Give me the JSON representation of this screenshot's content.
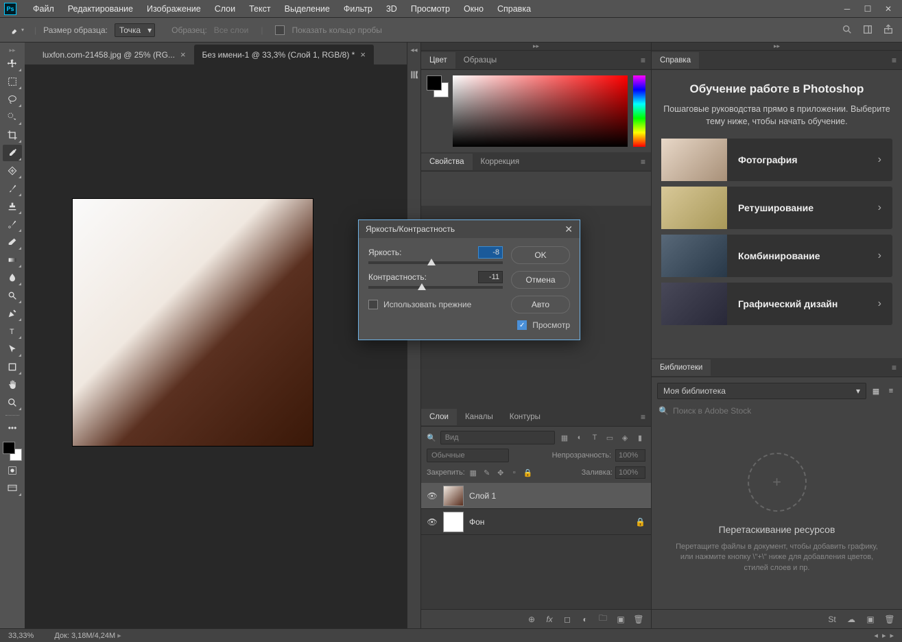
{
  "menu": [
    "Файл",
    "Редактирование",
    "Изображение",
    "Слои",
    "Текст",
    "Выделение",
    "Фильтр",
    "3D",
    "Просмотр",
    "Окно",
    "Справка"
  ],
  "options": {
    "sample_label": "Размер образца:",
    "sample_value": "Точка",
    "sample2_label": "Образец:",
    "sample2_value": "Все слои",
    "ring_label": "Показать кольцо пробы"
  },
  "tabs": [
    {
      "label": "luxfon.com-21458.jpg @ 25% (RG...",
      "active": false
    },
    {
      "label": "Без имени-1 @ 33,3% (Слой 1, RGB/8) *",
      "active": true
    }
  ],
  "color_tabs": [
    "Цвет",
    "Образцы"
  ],
  "props_tabs": [
    "Свойства",
    "Коррекция"
  ],
  "props_text": "",
  "layers_tabs": [
    "Слои",
    "Каналы",
    "Контуры"
  ],
  "layers": {
    "search_placeholder": "Вид",
    "blend": "Обычные",
    "opacity_label": "Непрозрачность:",
    "opacity_val": "100%",
    "lock_label": "Закрепить:",
    "fill_label": "Заливка:",
    "fill_val": "100%",
    "items": [
      {
        "name": "Слой 1",
        "active": true,
        "locked": false
      },
      {
        "name": "Фон",
        "active": false,
        "locked": true
      }
    ]
  },
  "help_tab": "Справка",
  "help": {
    "title": "Обучение работе в Photoshop",
    "sub": "Пошаговые руководства прямо в приложении. Выберите тему ниже, чтобы начать обучение.",
    "cards": [
      "Фотография",
      "Ретуширование",
      "Комбинирование",
      "Графический дизайн"
    ]
  },
  "lib_tab": "Библиотеки",
  "lib": {
    "select": "Моя библиотека",
    "search_placeholder": "Поиск в Adobe Stock",
    "drop_title": "Перетаскивание ресурсов",
    "drop_sub": "Перетащите файлы в документ, чтобы добавить графику, или нажмите кнопку \\\"+\\\" ниже для добавления цветов, стилей слоев и пр."
  },
  "status": {
    "zoom": "33,33%",
    "doc_label": "Док:",
    "doc_val": "3,18M/4,24M"
  },
  "dialog": {
    "title": "Яркость/Контрастность",
    "brightness_label": "Яркость:",
    "brightness_val": "-8",
    "contrast_label": "Контрастность:",
    "contrast_val": "-11",
    "legacy": "Использовать прежние",
    "preview": "Просмотр",
    "ok": "OK",
    "cancel": "Отмена",
    "auto": "Авто"
  }
}
